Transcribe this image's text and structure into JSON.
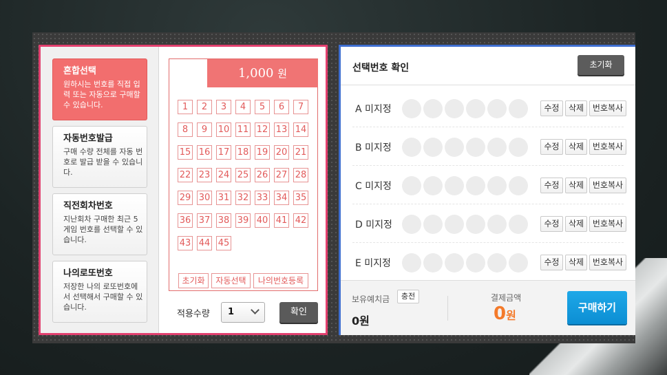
{
  "left": {
    "tabs": [
      {
        "title": "혼합선택",
        "desc": "원하시는 번호를 직접 입력 또는 자동으로 구매할 수 있습니다.",
        "active": true
      },
      {
        "title": "자동번호발급",
        "desc": "구매 수량 전체를 자동 번호로 발급 받을 수 있습니다.",
        "active": false
      },
      {
        "title": "직전회차번호",
        "desc": "지난회차 구매한 최근 5게임 번호를 선택할 수 있습니다.",
        "active": false
      },
      {
        "title": "나의로또번호",
        "desc": "저장한 나의 로또번호에서 선택해서 구매할 수 있습니다.",
        "active": false
      }
    ],
    "price": "1,000",
    "price_unit": "원",
    "numbers": [
      "1",
      "2",
      "3",
      "4",
      "5",
      "6",
      "7",
      "8",
      "9",
      "10",
      "11",
      "12",
      "13",
      "14",
      "15",
      "16",
      "17",
      "18",
      "19",
      "20",
      "21",
      "22",
      "23",
      "24",
      "25",
      "26",
      "27",
      "28",
      "29",
      "30",
      "31",
      "32",
      "33",
      "34",
      "35",
      "36",
      "37",
      "38",
      "39",
      "40",
      "41",
      "42",
      "43",
      "44",
      "45"
    ],
    "board_buttons": {
      "reset": "초기화",
      "auto": "자동선택",
      "register": "나의번호등록"
    },
    "qty_label": "적용수량",
    "qty_value": "1",
    "confirm": "확인"
  },
  "right": {
    "title": "선택번호 확인",
    "reset": "초기화",
    "rows": [
      {
        "label": "A 미지정"
      },
      {
        "label": "B 미지정"
      },
      {
        "label": "C 미지정"
      },
      {
        "label": "D 미지정"
      },
      {
        "label": "E 미지정"
      }
    ],
    "row_buttons": {
      "edit": "수정",
      "delete": "삭제",
      "copy": "번호복사"
    },
    "footer": {
      "deposit_label": "보유예치금",
      "charge": "충전",
      "deposit_value": "0원",
      "pay_label": "결제금액",
      "pay_value": "0",
      "pay_unit": "원",
      "buy": "구매하기"
    }
  }
}
